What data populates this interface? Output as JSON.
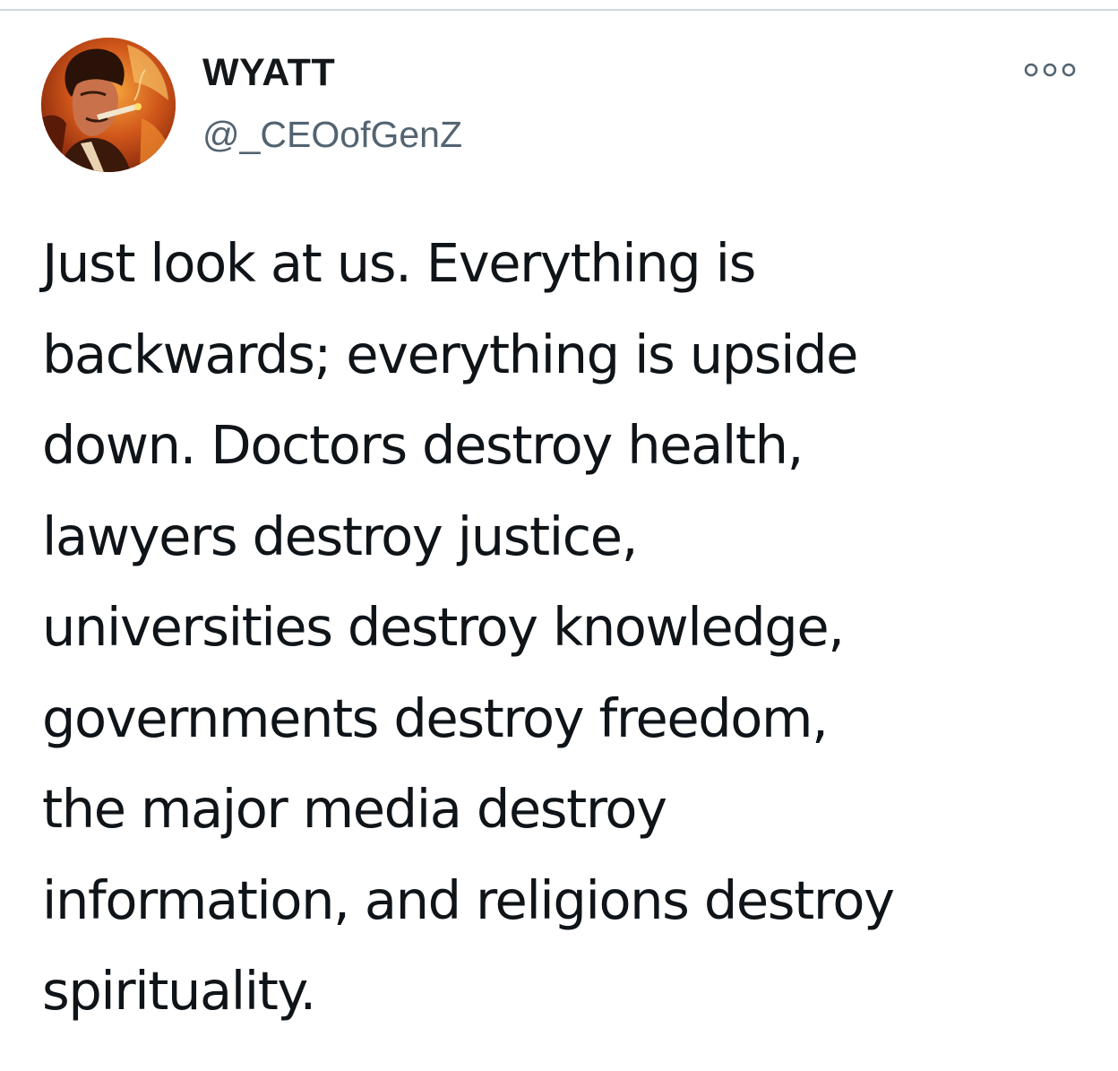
{
  "tweet": {
    "author": {
      "name": "WYATT",
      "handle": "@_CEOofGenZ",
      "avatar_icon": "profile-photo-avatar"
    },
    "more_icon": "more-options-icon",
    "text": "Just look at us. Everything is\nbackwards; everything is upside\ndown. Doctors destroy health,\nlawyers destroy justice,\nuniversities destroy knowledge,\ngovernments destroy freedom,\nthe major media destroy\ninformation, and religions destroy\nspirituality."
  },
  "colors": {
    "name": "#14171a",
    "handle": "#536471",
    "body_text": "#0f1419",
    "divider": "#cfd9de",
    "icon": "#536471"
  }
}
